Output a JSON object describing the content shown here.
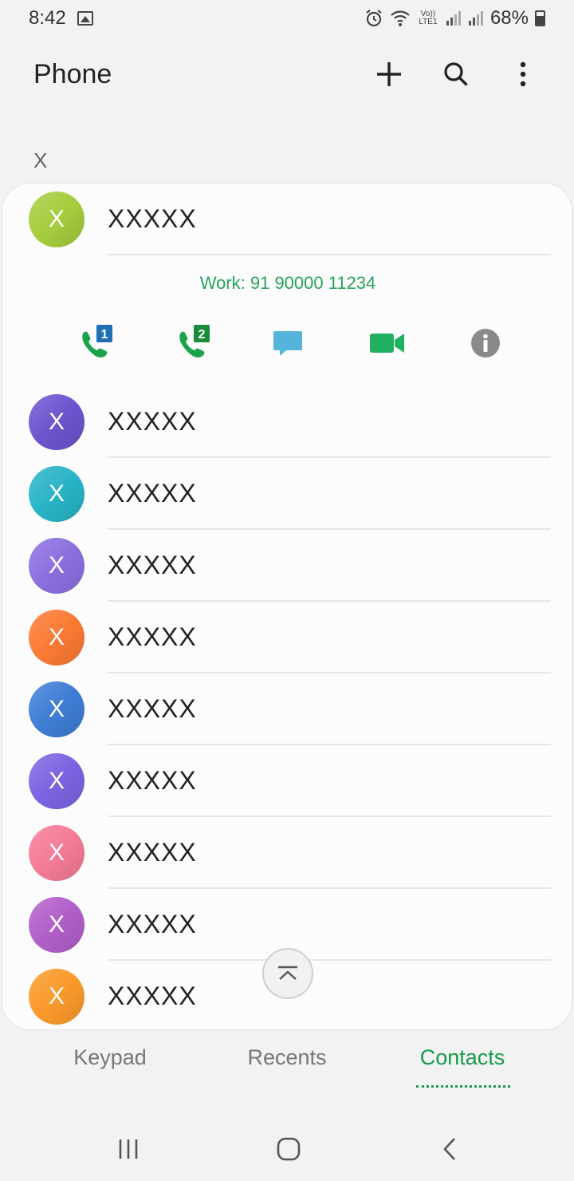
{
  "status_bar": {
    "time": "8:42",
    "battery": "68%",
    "icons": [
      "image-icon",
      "alarm-icon",
      "wifi-icon",
      "volte-icon",
      "signal-icon",
      "signal-icon",
      "battery-icon"
    ],
    "volte_label": "Vo)) LTE1"
  },
  "header": {
    "title": "Phone",
    "actions": [
      "plus-icon",
      "search-icon",
      "more-vert-icon"
    ]
  },
  "section_letter": "X",
  "expanded_contact": {
    "initial": "X",
    "name": "XXXXX",
    "phone": "Work: 91 90000 11234",
    "sim1_badge": "1",
    "sim2_badge": "2",
    "actions": [
      "call-sim1-icon",
      "call-sim2-icon",
      "message-icon",
      "video-call-icon",
      "info-icon"
    ]
  },
  "contacts": [
    {
      "initial": "X",
      "name": "XXXXX",
      "color": "#6d54cf"
    },
    {
      "initial": "X",
      "name": "XXXXX",
      "color": "#28b4c6"
    },
    {
      "initial": "X",
      "name": "XXXXX",
      "color": "#8c6fe0"
    },
    {
      "initial": "X",
      "name": "XXXXX",
      "color": "#fb7a33"
    },
    {
      "initial": "X",
      "name": "XXXXX",
      "color": "#3f7dd6"
    },
    {
      "initial": "X",
      "name": "XXXXX",
      "color": "#7d63e2"
    },
    {
      "initial": "X",
      "name": "XXXXX",
      "color": "#f57b96"
    },
    {
      "initial": "X",
      "name": "XXXXX",
      "color": "#b25fc9"
    },
    {
      "initial": "X",
      "name": "XXXXX",
      "color": "#fb9a2b"
    }
  ],
  "expanded_avatar_color": "#a6cd3e",
  "tabs": [
    {
      "label": "Keypad",
      "active": false
    },
    {
      "label": "Recents",
      "active": false
    },
    {
      "label": "Contacts",
      "active": true
    }
  ],
  "colors": {
    "accent_green": "#179a4c",
    "phone_green": "#25a25a",
    "call_green": "#1aa34a",
    "sim_badge_blue": "#1f6fb5",
    "sim_badge_green": "#1a8c3a",
    "message_blue": "#56b4dc",
    "video_green": "#1fb15f",
    "info_gray": "#8a8a8a"
  },
  "nav_bar": [
    "recent-apps-icon",
    "home-icon",
    "back-icon"
  ]
}
